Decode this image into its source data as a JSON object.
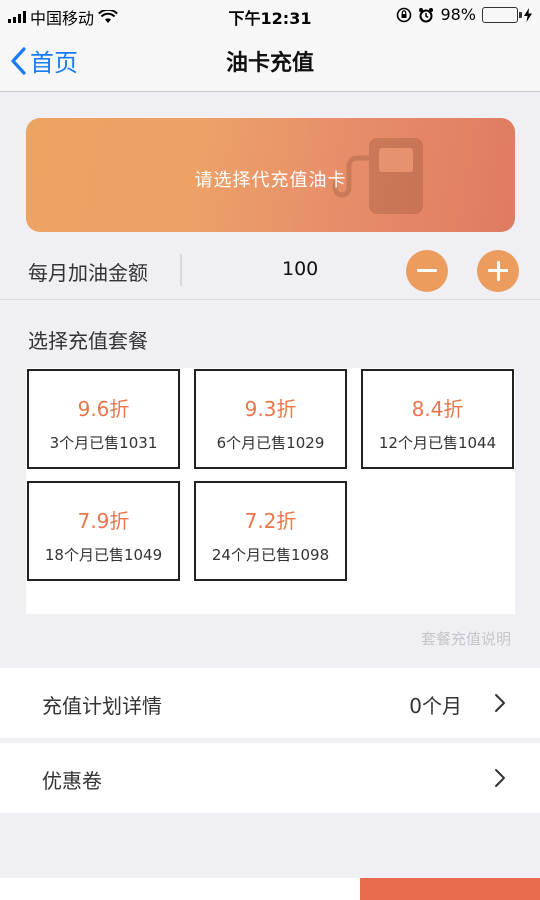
{
  "status_bar": {
    "carrier": "中国移动",
    "time": "下午12:31",
    "battery": "98%"
  },
  "nav": {
    "back_label": "首页",
    "title": "油卡充值"
  },
  "banner": {
    "text": "请选择代充值油卡"
  },
  "monthly": {
    "label": "每月加油金额",
    "amount": "100"
  },
  "packages": {
    "title": "选择充值套餐",
    "items": [
      {
        "discount": "9.6折",
        "sold": "3个月已售1031"
      },
      {
        "discount": "9.3折",
        "sold": "6个月已售1029"
      },
      {
        "discount": "8.4折",
        "sold": "12个月已售1044"
      },
      {
        "discount": "7.9折",
        "sold": "18个月已售1049"
      },
      {
        "discount": "7.2折",
        "sold": "24个月已售1098"
      }
    ],
    "note": "套餐充值说明"
  },
  "plan_row": {
    "label": "充值计划详情",
    "value": "0个月"
  },
  "coupon_row": {
    "label": "优惠卷"
  },
  "colors": {
    "accent": "#e9764b",
    "button": "#ec9d5e",
    "link": "#1a7cf5"
  }
}
